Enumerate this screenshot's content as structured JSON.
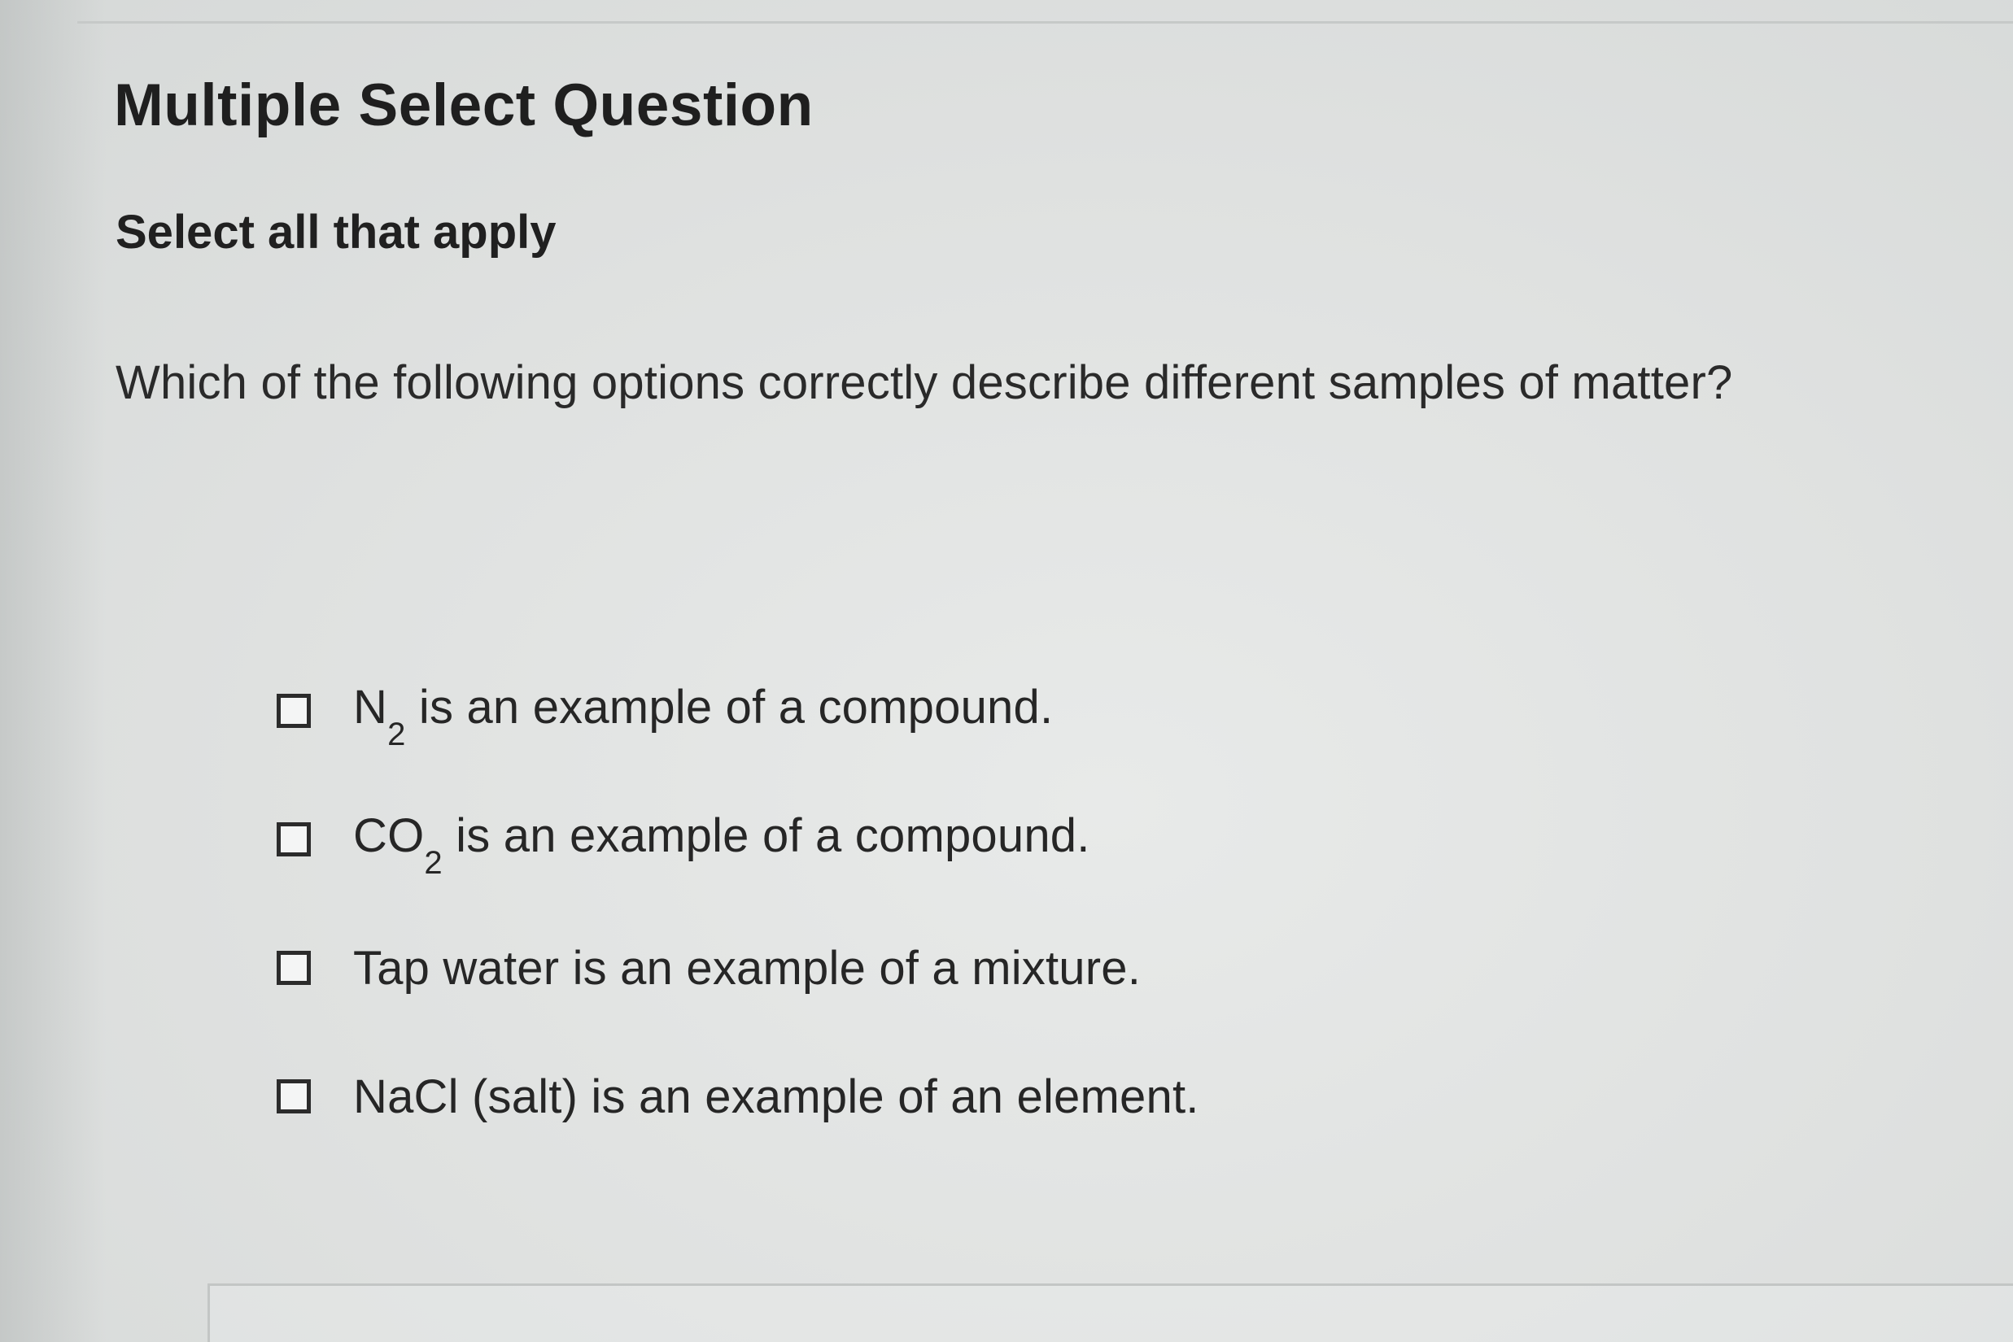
{
  "question_type": "Multiple Select Question",
  "instruction": "Select all that apply",
  "prompt": "Which of the following options correctly describe different samples of matter?",
  "options": [
    {
      "prefix": "N",
      "subscript": "2",
      "text": " is an example of a compound.",
      "checked": false
    },
    {
      "prefix": "CO",
      "subscript": "2",
      "text": " is an example of a compound.",
      "checked": false
    },
    {
      "prefix": "",
      "subscript": "",
      "text": "Tap water is an example of a mixture.",
      "checked": false
    },
    {
      "prefix": "",
      "subscript": "",
      "text": "NaCl (salt) is an example of an element.",
      "checked": false
    }
  ]
}
